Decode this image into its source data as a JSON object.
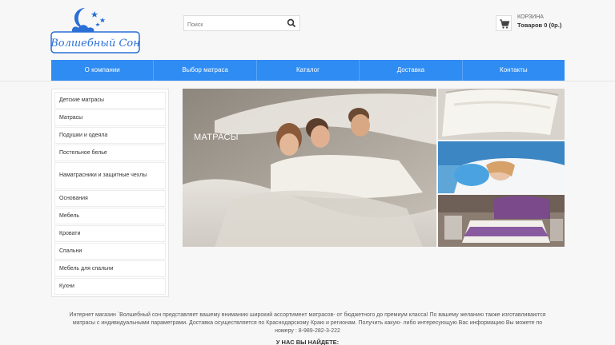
{
  "logo": {
    "text": "Волшебный Сон"
  },
  "search": {
    "placeholder": "Поиск",
    "icon": "search-icon"
  },
  "cart": {
    "label": "КОРЗИНА",
    "count_text": "Товаров 0 (0р.)",
    "icon": "cart-icon"
  },
  "nav": {
    "items": [
      {
        "label": "О компании"
      },
      {
        "label": "Выбор матраса"
      },
      {
        "label": "Каталог"
      },
      {
        "label": "Доставка"
      },
      {
        "label": "Контакты"
      }
    ]
  },
  "sidebar": {
    "items": [
      {
        "label": "Детские матрасы"
      },
      {
        "label": "Матрасы"
      },
      {
        "label": "Подушки и одеяла"
      },
      {
        "label": "Постельное белье"
      },
      {
        "label": "Наматрасники и защитные чехлы"
      },
      {
        "label": "Основания"
      },
      {
        "label": "Мебель"
      },
      {
        "label": "Кровати"
      },
      {
        "label": "Спальни"
      },
      {
        "label": "Мебель для спальни"
      },
      {
        "label": "Кухни"
      }
    ]
  },
  "hero": {
    "title": "МАТРАСЫ"
  },
  "about": {
    "text": "Интернет магазин `Волшебный сон представляет вашему вниманию широкий ассортимент матрасов- от бюджетного до премиум класса! По вашему желанию также изготавливаются матрасы с индивидуальными параметрами. Доставка осуществляется по Краснодарскому Краю и регионам. Получить какую- либо интересующую Вас информацию Вы можете по номеру : 8-989-282-3-222",
    "heading": "У НАС ВЫ НАЙДЕТЕ:"
  },
  "colors": {
    "accent": "#2f8cf2",
    "logo": "#2a6fd6"
  }
}
